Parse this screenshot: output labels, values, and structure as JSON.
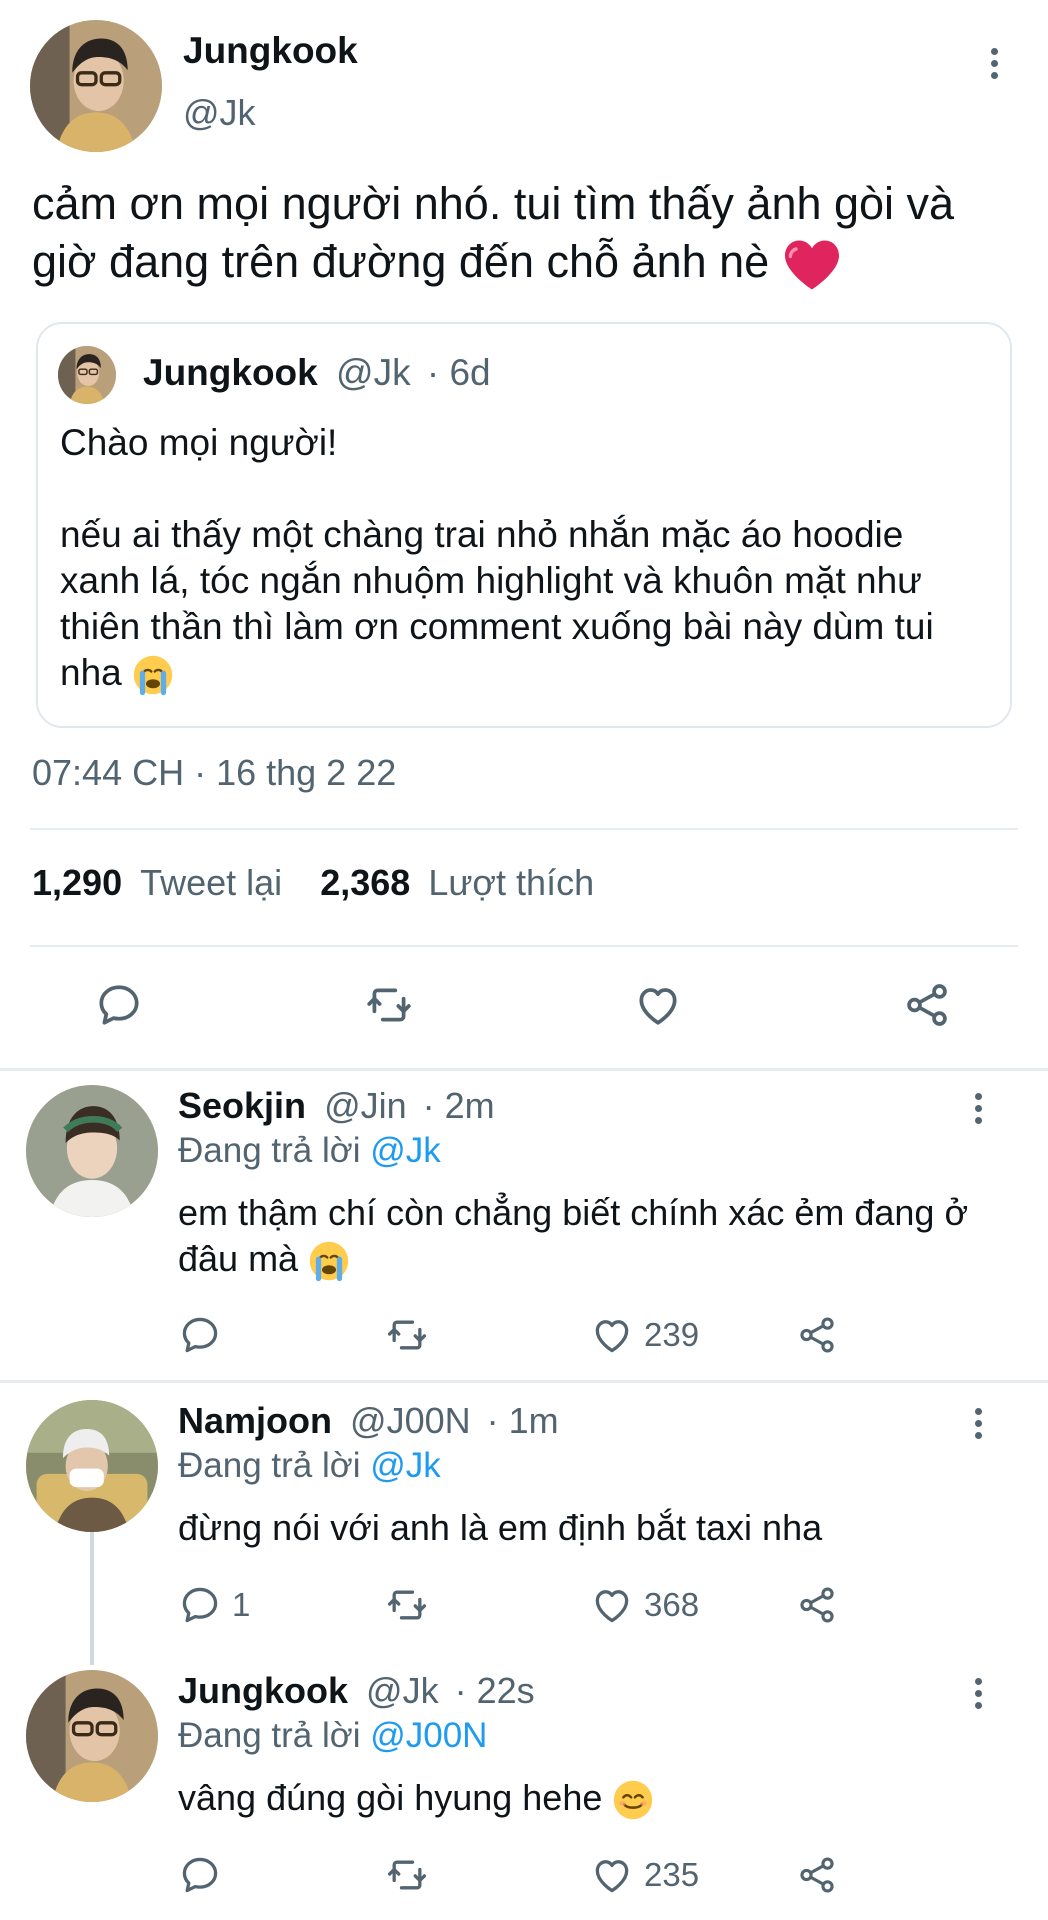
{
  "main_tweet": {
    "author_name": "Jungkook",
    "author_handle": "@Jk",
    "avatar": "avatar-jungkook",
    "text": "cảm ơn mọi người nhó. tui tìm thấy ảnh gòi và giờ đang trên đường đến chỗ ảnh nè",
    "text_emoji": "red-heart",
    "more_icon": "more-vertical-icon",
    "quoted": {
      "author_name": "Jungkook",
      "author_handle": "@Jk",
      "time": "· 6d",
      "line1": "Chào mọi người!",
      "body": "nếu ai thấy một chàng trai nhỏ nhắn mặc áo hoodie xanh lá, tóc ngắn nhuộm highlight và khuôn mặt như thiên thần thì làm ơn comment xuống bài này dùm tui nha",
      "body_emoji": "crying-face"
    },
    "timestamp": "07:44 CH · 16 thg 2 22",
    "retweets_count": "1,290",
    "retweets_label": "Tweet lại",
    "likes_count": "2,368",
    "likes_label": "Lượt thích",
    "actions": [
      "reply-icon",
      "retweet-icon",
      "heart-icon",
      "share-icon"
    ]
  },
  "replies": [
    {
      "author_name": "Seokjin",
      "author_handle": "@Jin",
      "time": "· 2m",
      "replying_prefix": "Đang trả lời",
      "replying_to": "@Jk",
      "text": "em thậm chí còn chẳng biết chính xác ẻm đang ở đâu mà",
      "emoji": "crying-face",
      "reply_count": "",
      "like_count": "239"
    },
    {
      "author_name": "Namjoon",
      "author_handle": "@J00N",
      "time": "· 1m",
      "replying_prefix": "Đang trả lời",
      "replying_to": "@Jk",
      "text": "đừng nói với anh là em định bắt taxi nha",
      "emoji": "",
      "reply_count": "1",
      "like_count": "368"
    },
    {
      "author_name": "Jungkook",
      "author_handle": "@Jk",
      "time": "· 22s",
      "replying_prefix": "Đang trả lời",
      "replying_to": "@J00N",
      "text": "vâng đúng gòi hyung hehe",
      "emoji": "smiling-face",
      "reply_count": "",
      "like_count": "235"
    }
  ],
  "colors": {
    "text": "#0f1419",
    "muted": "#536471",
    "link": "#1d9bf0",
    "divider": "#e6ecf0",
    "heart_emoji": "#e0245e"
  }
}
